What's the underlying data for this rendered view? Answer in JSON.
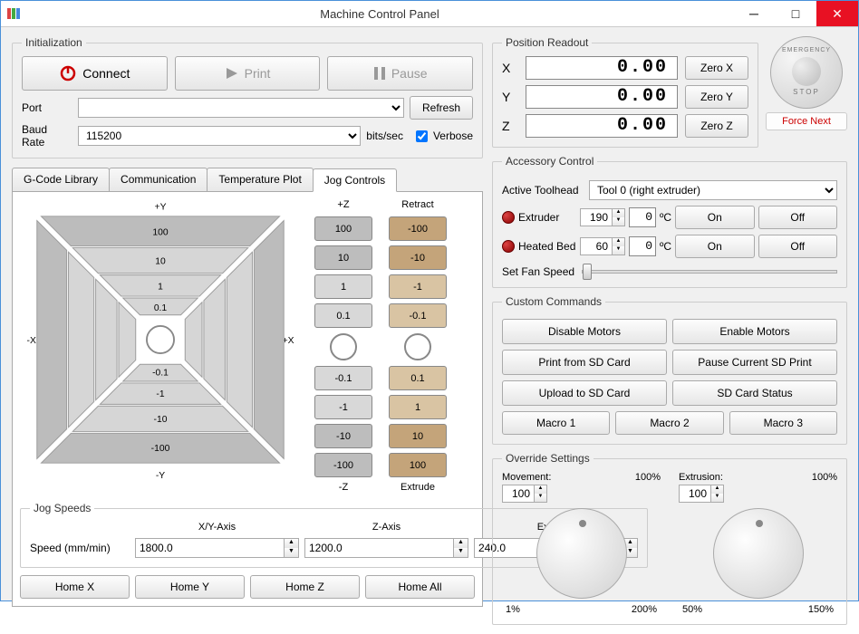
{
  "window": {
    "title": "Machine Control Panel"
  },
  "init": {
    "legend": "Initialization",
    "connect": "Connect",
    "print": "Print",
    "pause": "Pause",
    "port_label": "Port",
    "refresh": "Refresh",
    "baud_label": "Baud Rate",
    "baud_value": "115200",
    "baud_units": "bits/sec",
    "verbose_label": "Verbose"
  },
  "tabs": {
    "gcode": "G-Code Library",
    "comm": "Communication",
    "temp": "Temperature Plot",
    "jog": "Jog Controls"
  },
  "jog": {
    "yp": "+Y",
    "ym": "-Y",
    "xp": "+X",
    "xm": "-X",
    "zp": "+Z",
    "zm": "-Z",
    "retract": "Retract",
    "extrude": "Extrude",
    "v100": "100",
    "v10": "10",
    "v1": "1",
    "v01": "0.1",
    "vn01": "-0.1",
    "vn1": "-1",
    "vn10": "-10",
    "vn100": "-100",
    "r100": "-100",
    "r10": "-10",
    "r1": "-1",
    "r01": "-0.1",
    "e01": "0.1",
    "e1": "1",
    "e10": "10",
    "e100": "100"
  },
  "speeds": {
    "legend": "Jog Speeds",
    "head_xy": "X/Y-Axis",
    "head_z": "Z-Axis",
    "head_e": "Extruder",
    "row_label": "Speed (mm/min)",
    "xy": "1800.0",
    "z": "1200.0",
    "e": "240.0"
  },
  "home": {
    "x": "Home X",
    "y": "Home Y",
    "z": "Home Z",
    "all": "Home All"
  },
  "pos": {
    "legend": "Position Readout",
    "x": "X",
    "y": "Y",
    "z": "Z",
    "val_x": "0.00",
    "val_y": "0.00",
    "val_z": "0.00",
    "zero_x": "Zero X",
    "zero_y": "Zero Y",
    "zero_z": "Zero Z"
  },
  "estop": {
    "top": "EMERGENCY",
    "bot": "STOP",
    "force": "Force Next"
  },
  "acc": {
    "legend": "Accessory Control",
    "toolhead_label": "Active Toolhead",
    "toolhead_value": "Tool 0 (right extruder)",
    "extruder_label": "Extruder",
    "extruder_set": "190",
    "extruder_read": "0",
    "bed_label": "Heated Bed",
    "bed_set": "60",
    "bed_read": "0",
    "deg": "ºC",
    "on": "On",
    "off": "Off",
    "fan_label": "Set Fan Speed"
  },
  "cc": {
    "legend": "Custom Commands",
    "disable": "Disable Motors",
    "enable": "Enable Motors",
    "printsd": "Print from SD Card",
    "pausesd": "Pause Current SD Print",
    "upload": "Upload to SD Card",
    "status": "SD Card Status",
    "m1": "Macro 1",
    "m2": "Macro 2",
    "m3": "Macro 3"
  },
  "ovr": {
    "legend": "Override Settings",
    "move_label": "Movement:",
    "move_pct": "100%",
    "move_val": "100",
    "move_min": "1%",
    "move_max": "200%",
    "ext_label": "Extrusion:",
    "ext_pct": "100%",
    "ext_val": "100",
    "ext_min": "50%",
    "ext_max": "150%"
  }
}
